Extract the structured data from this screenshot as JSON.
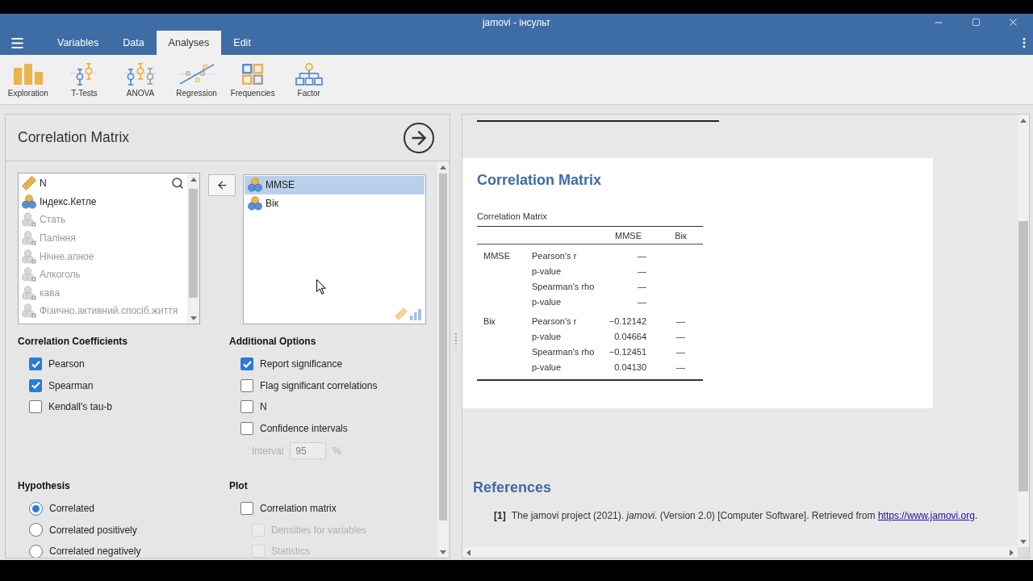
{
  "window": {
    "title": "jamovi - інсульт"
  },
  "ribbon_tabs": [
    {
      "label": "Variables",
      "selected": false
    },
    {
      "label": "Data",
      "selected": false
    },
    {
      "label": "Analyses",
      "selected": true
    },
    {
      "label": "Edit",
      "selected": false
    }
  ],
  "toolbar": [
    {
      "kind": "exploration",
      "label": "Exploration"
    },
    {
      "kind": "t-tests",
      "label": "T-Tests"
    },
    {
      "kind": "anova",
      "label": "ANOVA"
    },
    {
      "kind": "regression",
      "label": "Regression"
    },
    {
      "kind": "frequencies",
      "label": "Frequencies"
    },
    {
      "kind": "factor",
      "label": "Factor"
    }
  ],
  "options_panel": {
    "title": "Correlation Matrix",
    "variables": [
      {
        "name": "N",
        "kind": "continuous",
        "disabled": false,
        "selected": false
      },
      {
        "name": "Індекс.Кетле",
        "kind": "nominal",
        "disabled": false,
        "selected": false
      },
      {
        "name": "Стать",
        "kind": "nominal-text",
        "disabled": true,
        "selected": false
      },
      {
        "name": "Паління",
        "kind": "nominal-text",
        "disabled": true,
        "selected": false
      },
      {
        "name": "Нічне.апное",
        "kind": "nominal-text",
        "disabled": true,
        "selected": false
      },
      {
        "name": "Алкоголь",
        "kind": "nominal-text",
        "disabled": true,
        "selected": false
      },
      {
        "name": "кава",
        "kind": "nominal-text",
        "disabled": true,
        "selected": false
      },
      {
        "name": "Фізично.активний.спосіб.життя",
        "kind": "nominal-text",
        "disabled": true,
        "selected": false
      }
    ],
    "selected_variables": [
      {
        "name": "MMSE",
        "kind": "nominal",
        "selected": true
      },
      {
        "name": "Вік",
        "kind": "nominal",
        "selected": false
      }
    ],
    "correlation_coefficients": {
      "heading": "Correlation Coefficients",
      "options": [
        {
          "kind": "checkbox",
          "label": "Pearson",
          "checked": true
        },
        {
          "kind": "checkbox",
          "label": "Spearman",
          "checked": true
        },
        {
          "kind": "checkbox",
          "label": "Kendall's tau-b",
          "checked": false
        }
      ]
    },
    "additional_options": {
      "heading": "Additional Options",
      "options": [
        {
          "kind": "checkbox",
          "label": "Report significance",
          "checked": true
        },
        {
          "kind": "checkbox",
          "label": "Flag significant correlations",
          "checked": false
        },
        {
          "kind": "checkbox",
          "label": "N",
          "checked": false
        },
        {
          "kind": "checkbox",
          "label": "Confidence intervals",
          "checked": false,
          "children": [
            {
              "kind": "number",
              "label": "Interval",
              "value": "95",
              "unit": "%",
              "disabled": true
            }
          ]
        }
      ]
    },
    "hypothesis": {
      "heading": "Hypothesis",
      "options": [
        {
          "label": "Correlated",
          "selected": true
        },
        {
          "label": "Correlated positively",
          "selected": false
        },
        {
          "label": "Correlated negatively",
          "selected": false
        }
      ]
    },
    "plot": {
      "heading": "Plot",
      "options": [
        {
          "kind": "checkbox",
          "label": "Correlation matrix",
          "checked": false,
          "children": [
            {
              "kind": "checkbox",
              "label": "Densities for variables",
              "checked": false,
              "disabled": true
            },
            {
              "kind": "checkbox",
              "label": "Statistics",
              "checked": false,
              "disabled": true
            }
          ]
        }
      ]
    }
  },
  "results": {
    "title": "Correlation Matrix",
    "table": {
      "caption": "Correlation Matrix",
      "columns": [
        "MMSE",
        "Вік"
      ],
      "groups": [
        {
          "variable": "MMSE",
          "rows": [
            {
              "statistic": "Pearson's r",
              "values": [
                "—"
              ]
            },
            {
              "statistic": "p-value",
              "values": [
                "—"
              ]
            },
            {
              "statistic": "Spearman's rho",
              "values": [
                "—"
              ]
            },
            {
              "statistic": "p-value",
              "values": [
                "—"
              ]
            }
          ]
        },
        {
          "variable": "Вік",
          "rows": [
            {
              "statistic": "Pearson's r",
              "values": [
                "−0.12142",
                "—"
              ]
            },
            {
              "statistic": "p-value",
              "values": [
                "0.04664",
                "—"
              ]
            },
            {
              "statistic": "Spearman's rho",
              "values": [
                "−0.12451",
                "—"
              ]
            },
            {
              "statistic": "p-value",
              "values": [
                "0.04130",
                "—"
              ]
            }
          ]
        }
      ]
    }
  },
  "references": {
    "heading": "References",
    "items": [
      {
        "number": "[1]",
        "text": "The jamovi project (2021). *jamovi*. (Version 2.0) [Computer Software]. Retrieved from",
        "link": "https://www.jamovi.org",
        "after": "."
      }
    ]
  }
}
